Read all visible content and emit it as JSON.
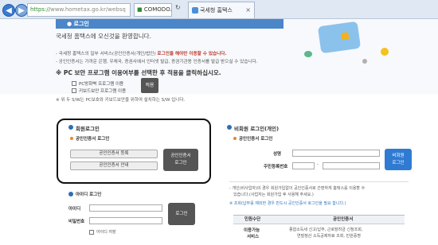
{
  "browser": {
    "address_scheme": "https://",
    "address_rest": "www.hometax.go.kr/websq",
    "cert_text": "COMODO...",
    "tab_title": "국세청 홈택스",
    "back_label": "◀",
    "forward_label": "▶"
  },
  "header": {
    "login_tab": "로그인",
    "welcome": "국세청 홈택스에 오신것을 환영합니다.",
    "notice1_a": "- 국세청 홈택스의 일부 서비스(공인인증서(개인/법인)",
    "notice1_red": "로그인을 해야만 이용할 수 있습니다.",
    "notice2": "- 공인인증서는 가까운 은행, 우체국, 증권사에서 인터넷 발급, 증권기관용 인증서를 발급 받으실 수 있습니다.",
    "pc_question": "※ PC 보안 프로그램 이용여부를 선택한 후 적용을 클릭하십시오.",
    "opt1": "PC방화벽 프로그램 이용",
    "opt2": "키보드보안 프로그램 이용",
    "apply": "적용",
    "note": "※ 위 두 S/W는 PC보호와 키보드보안을 위하여 설치하는 S/W 입니다."
  },
  "member": {
    "title": "회원로그인",
    "cert_sub": "공인인증서 로그인",
    "register_btn": "공인인증서 등록",
    "guide_btn": "공인인증서 안내",
    "cert_login_line1": "공인인증서",
    "cert_login_line2": "로그인",
    "id_title": "아이디 로그인",
    "id_label": "아이디",
    "pw_label": "비밀번호",
    "login_btn": "로그인",
    "save_id": "아이디 저장"
  },
  "nonmember": {
    "title": "비회원 로그인(개인)",
    "cert_sub": "공인인증서 로그인",
    "name_label": "성명",
    "rrn_label": "주민등록번호",
    "dash": "-",
    "btn_line1": "비회원",
    "btn_line2": "로그인",
    "note1": "- 개인(비사업자)의 경우 회원가입없이 공인인증서로 간편하게 홈택스를 이용할 수",
    "note2": "있습니다.(사업자는 회원가입 후 사용해 주세요.)",
    "note3": "※ 조회(납부를 제외한 경우 반드시 공인인증서 로그인을 필요 합니다.)",
    "svc_col1": "민원수단",
    "svc_col2": "공인인증서",
    "svc_row_label1": "이용가능",
    "svc_row_label2": "서비스",
    "svc_row_text1": "종합소득세 신고/납부, 근로장려금 신청조회,",
    "svc_row_text2": "연말정산 소득공제자료 조회, 민원증명"
  }
}
